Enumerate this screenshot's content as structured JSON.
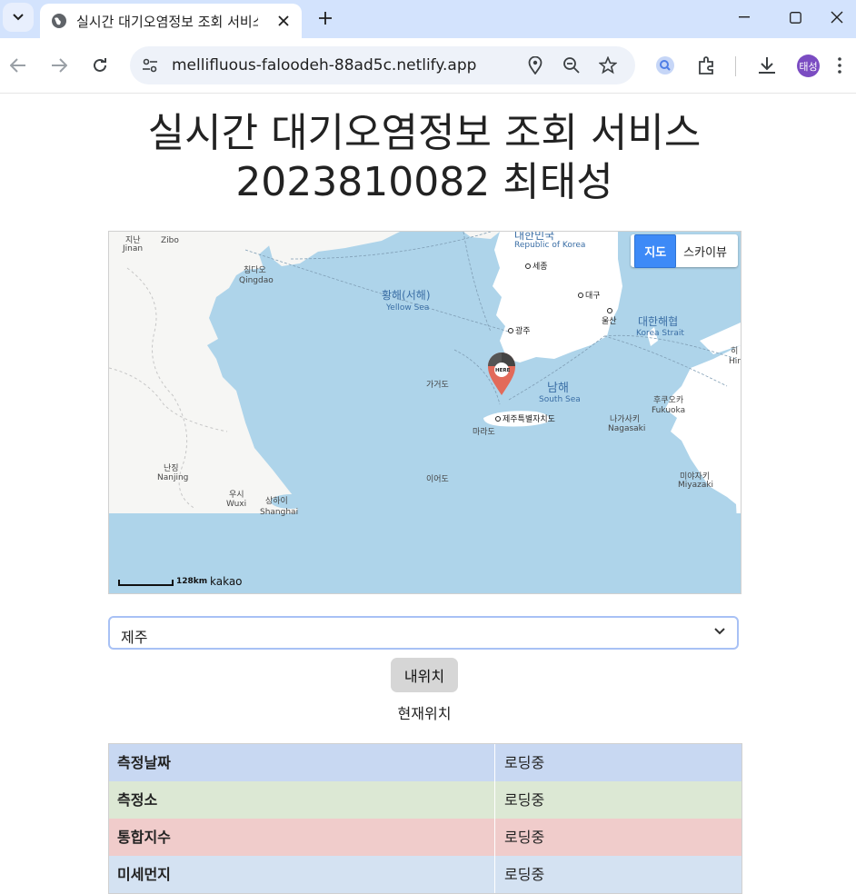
{
  "browser": {
    "tab_title": "실시간 대기오염정보 조회 서비스",
    "url": "mellifluous-faloodeh-88ad5c.netlify.app",
    "profile_initials": "태성"
  },
  "page": {
    "title_line1": "실시간 대기오염정보 조회 서비스",
    "title_line2": "2023810082 최태성"
  },
  "map": {
    "type_buttons": {
      "map": "지도",
      "skyview": "스카이뷰"
    },
    "scale_label": "128km",
    "provider": "kakao",
    "marker_label": "HERE",
    "labels": {
      "jinan_ko": "지난",
      "jinan_en": "Jinan",
      "zibo": "Zibo",
      "qingdao_ko": "칭다오",
      "qingdao_en": "Qingdao",
      "korea_ko": "대한민국",
      "korea_en": "Republic of Korea",
      "sejong": "세종",
      "daegu": "대구",
      "ulsan": "울산",
      "gwangju": "광주",
      "yellow_sea_ko": "황해(서해)",
      "yellow_sea_en": "Yellow Sea",
      "korea_strait_ko": "대한해협",
      "korea_strait_en": "Korea Strait",
      "south_sea_ko": "남해",
      "south_sea_en": "South Sea",
      "gageodo": "가거도",
      "jeju": "제주특별자치도",
      "marado": "마라도",
      "fukuoka_ko": "후쿠오카",
      "fukuoka_en": "Fukuoka",
      "nagasaki_ko": "나가사키",
      "nagasaki_en": "Nagasaki",
      "nanjing_ko": "난징",
      "nanjing_en": "Nanjing",
      "wuxi_ko": "우시",
      "wuxi_en": "Wuxi",
      "shanghai_ko": "상하이",
      "shanghai_en": "Shanghai",
      "ieodo": "이어도",
      "miyazaki_ko": "미야자키",
      "miyazaki_en": "Miyazaki",
      "hiro_ko": "히",
      "hiro_en": "Hir"
    }
  },
  "controls": {
    "region_selected": "제주",
    "locate_button": "내위치",
    "current_location_label": "현재위치"
  },
  "table": {
    "rows": [
      {
        "key": "측정날짜",
        "value": "로딩중",
        "color": "#c8d8f2"
      },
      {
        "key": "측정소",
        "value": "로딩중",
        "color": "#dce8d4"
      },
      {
        "key": "통합지수",
        "value": "로딩중",
        "color": "#f0cccb"
      },
      {
        "key": "미세먼지",
        "value": "로딩중",
        "color": "#d4e2f2"
      }
    ]
  },
  "colors": {
    "tabbar": "#d3e3fd",
    "sea": "#aed4ea",
    "land": "#f6f6f4",
    "accent": "#3d8af7",
    "marker": "#e26a5a"
  }
}
